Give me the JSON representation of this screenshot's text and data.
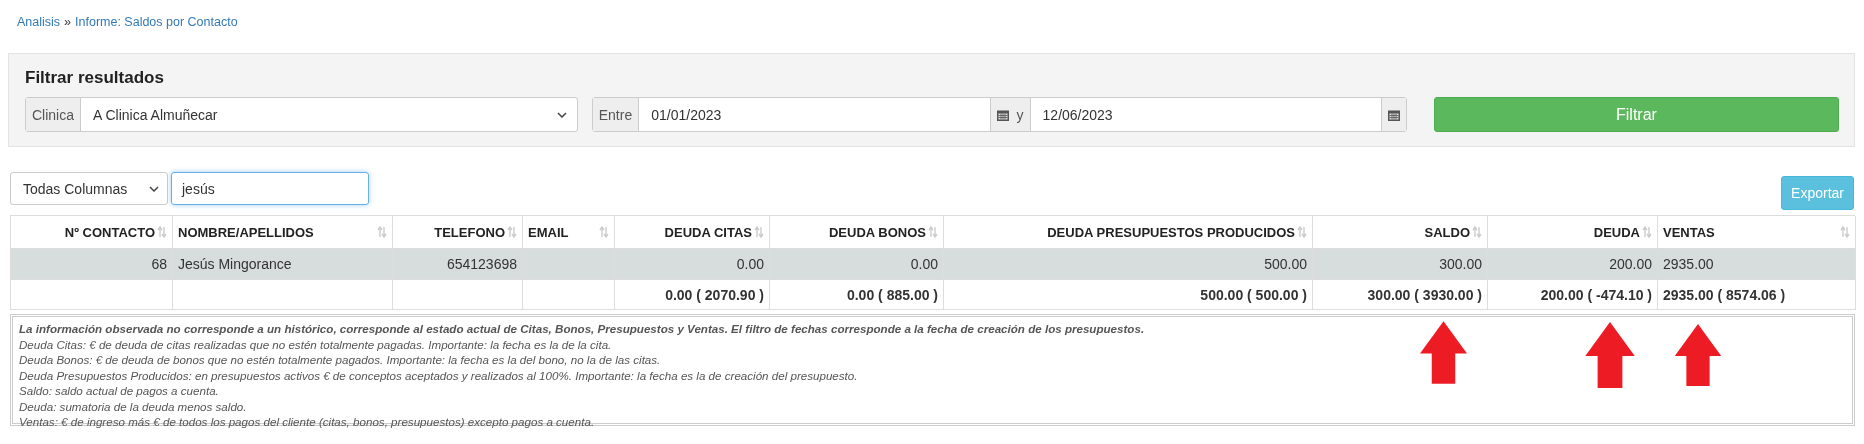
{
  "breadcrumb": [
    {
      "label": "Analisis"
    },
    {
      "label": "Informe: Saldos por Contacto"
    }
  ],
  "breadcrumb_separator": "»",
  "filter": {
    "title": "Filtrar resultados",
    "clinic_label": "Clinica",
    "clinic_value": "A Clinica Almuñecar",
    "range_label": "Entre",
    "date_from": "01/01/2023",
    "range_joiner": "y",
    "date_to": "12/06/2023",
    "submit": "Filtrar"
  },
  "search": {
    "column_select": "Todas Columnas",
    "value": "jesús"
  },
  "export_button": "Exportar",
  "table": {
    "columns": [
      {
        "label": "Nº CONTACTO"
      },
      {
        "label": "NOMBRE/APELLIDOS"
      },
      {
        "label": "TELEFONO"
      },
      {
        "label": "EMAIL"
      },
      {
        "label": "DEUDA CITAS"
      },
      {
        "label": "DEUDA BONOS"
      },
      {
        "label": "DEUDA PRESUPUESTOS PRODUCIDOS"
      },
      {
        "label": "SALDO"
      },
      {
        "label": "DEUDA"
      },
      {
        "label": "VENTAS"
      }
    ],
    "rows": [
      {
        "highlighted": true,
        "cells": [
          "68",
          "Jesús Mingorance",
          "654123698",
          "",
          "0.00",
          "0.00",
          "500.00",
          "300.00",
          "200.00",
          "2935.00"
        ]
      }
    ],
    "totals": [
      "0.00 ( 2070.90 )",
      "0.00 ( 885.00 )",
      "500.00 ( 500.00 )",
      "300.00 ( 3930.00 )",
      "200.00 ( -474.10 )",
      "2935.00 ( 8574.06 )"
    ]
  },
  "notes": {
    "heading": "La información observada no corresponde a un histórico, corresponde al estado actual de Citas, Bonos, Presupuestos y Ventas. El filtro de fechas corresponde a la fecha de creación de los presupuestos.",
    "lines": [
      "Deuda Citas: € de deuda de citas realizadas que no estén totalmente pagadas. Importante: la fecha es la de la cita.",
      "Deuda Bonos: € de deuda de bonos que no estén totalmente pagados. Importante: la fecha es la del bono, no la de las citas.",
      "Deuda Presupuestos Producidos: en presupuestos activos € de conceptos aceptados y realizados al 100%. Importante: la fecha es la de creación del presupuesto.",
      "Saldo: saldo actual de pagos a cuenta.",
      "Deuda: sumatoria de la deuda menos saldo.",
      "Ventas: € de ingreso más € de todos los pagos del cliente (citas, bonos, presupuestos) excepto pagos a cuenta."
    ]
  }
}
